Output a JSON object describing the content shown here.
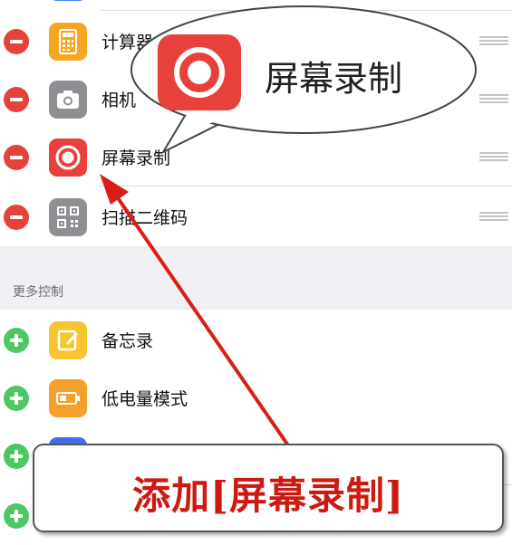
{
  "included_controls": [
    {
      "label": "计算器",
      "icon": "calculator-icon",
      "icon_color": "#f6a623"
    },
    {
      "label": "相机",
      "icon": "camera-icon",
      "icon_color": "#8e8e93"
    },
    {
      "label": "屏幕录制",
      "icon": "screen-record-icon",
      "icon_color": "#e8413b"
    },
    {
      "label": "扫描二维码",
      "icon": "qr-code-icon",
      "icon_color": "#8e8e93"
    }
  ],
  "more_controls_header": "更多控制",
  "more_controls": [
    {
      "label": "备忘录",
      "icon": "notes-icon",
      "icon_color": "#f7c531"
    },
    {
      "label": "低电量模式",
      "icon": "battery-icon",
      "icon_color": "#f5a02a"
    }
  ],
  "bubble": {
    "label": "屏幕录制",
    "icon": "screen-record-icon",
    "icon_color": "#e8413b"
  },
  "callout": {
    "text": "添加[屏幕录制]",
    "text_color": "#cc1a12"
  },
  "colors": {
    "remove": "#e6413b",
    "add": "#4cc763",
    "arrow": "#d81e17"
  }
}
